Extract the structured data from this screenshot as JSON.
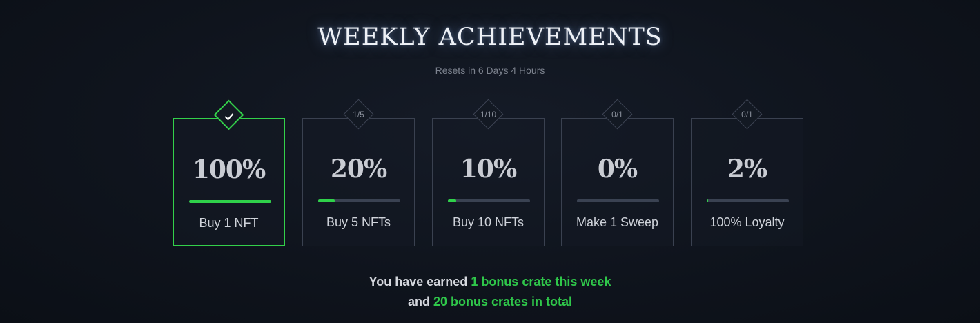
{
  "header": {
    "title": "WEEKLY ACHIEVEMENTS",
    "subtitle": "Resets in 6 Days 4 Hours"
  },
  "colors": {
    "accent_green": "#2fc74a",
    "card_border": "#3a4150",
    "background": "#0f141d"
  },
  "achievements": [
    {
      "badge": "",
      "badge_icon": "check-icon",
      "percent_label": "100%",
      "progress": 1.0,
      "label": "Buy 1 NFT",
      "completed": true
    },
    {
      "badge": "1/5",
      "percent_label": "20%",
      "progress": 0.2,
      "label": "Buy 5 NFTs",
      "completed": false
    },
    {
      "badge": "1/10",
      "percent_label": "10%",
      "progress": 0.1,
      "label": "Buy 10 NFTs",
      "completed": false
    },
    {
      "badge": "0/1",
      "percent_label": "0%",
      "progress": 0.0,
      "label": "Make 1 Sweep",
      "completed": false
    },
    {
      "badge": "0/1",
      "percent_label": "2%",
      "progress": 0.02,
      "label": "100% Loyalty",
      "completed": false
    }
  ],
  "footer": {
    "line1_prefix": "You have earned ",
    "line1_highlight": "1 bonus crate this week",
    "line2_prefix": "and ",
    "line2_highlight": "20 bonus crates in total"
  }
}
